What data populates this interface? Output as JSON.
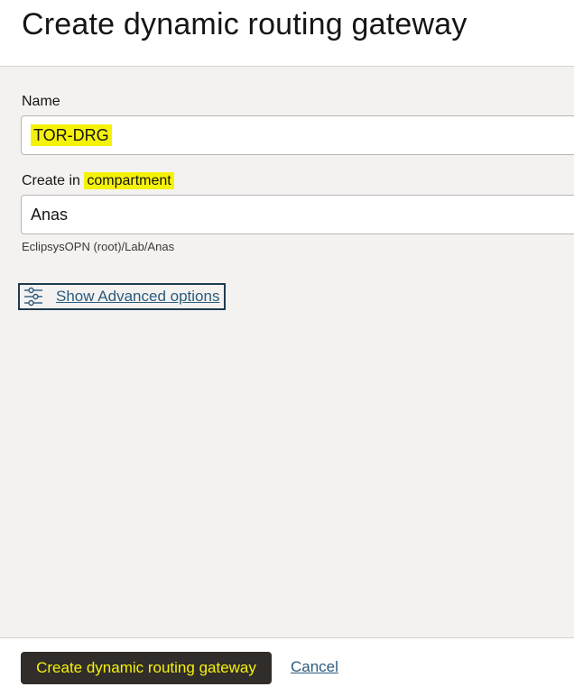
{
  "header": {
    "title": "Create dynamic routing gateway"
  },
  "form": {
    "name_label": "Name",
    "name_value": "TOR-DRG",
    "compartment_label_prefix": "Create in",
    "compartment_label_highlight": "compartment",
    "compartment_value": "Anas",
    "compartment_path": "EclipsysOPN (root)/Lab/Anas",
    "advanced_label": "Show Advanced options",
    "advanced_icon": "sliders-icon"
  },
  "footer": {
    "create_label": "Create dynamic routing gateway",
    "cancel_label": "Cancel"
  },
  "colors": {
    "highlight": "#f5f20a",
    "primary_button": "#312d2a",
    "link": "#2c5b7d"
  }
}
